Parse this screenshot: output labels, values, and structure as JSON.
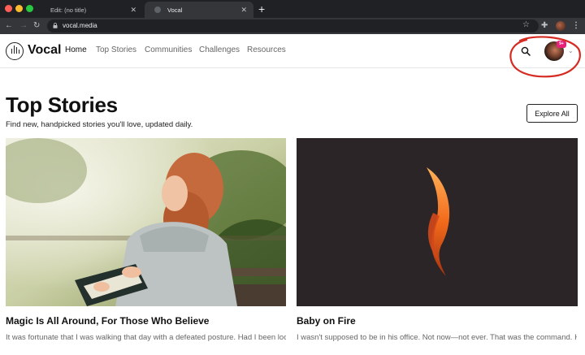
{
  "browser": {
    "tabs": [
      {
        "title": "Edit: (no title)"
      },
      {
        "title": "Vocal"
      }
    ],
    "url": "vocal.media",
    "colors": {
      "close": "#ff5f57",
      "minimize": "#febc2e",
      "zoom": "#28c840"
    }
  },
  "site": {
    "logo": "Vocal",
    "nav": [
      "Home",
      "Top Stories",
      "Communities",
      "Challenges",
      "Resources"
    ],
    "active_nav": "Home",
    "notification_count": "9+",
    "accent": "#e9207a"
  },
  "page": {
    "title": "Top Stories",
    "subtitle": "Find new, handpicked stories you'll love, updated daily.",
    "explore_label": "Explore All"
  },
  "stories": [
    {
      "title": "Magic Is All Around, For Those Who Believe",
      "excerpt": "It was fortunate that I was walking that day with a defeated posture. Had I been looking up instead of down, I probably would have walked past it, dismissing it"
    },
    {
      "title": "Baby on Fire",
      "excerpt": "I wasn't supposed to be in his office. Not now—not ever. That was the command. His command. First, it started with the office, now the basement."
    }
  ]
}
